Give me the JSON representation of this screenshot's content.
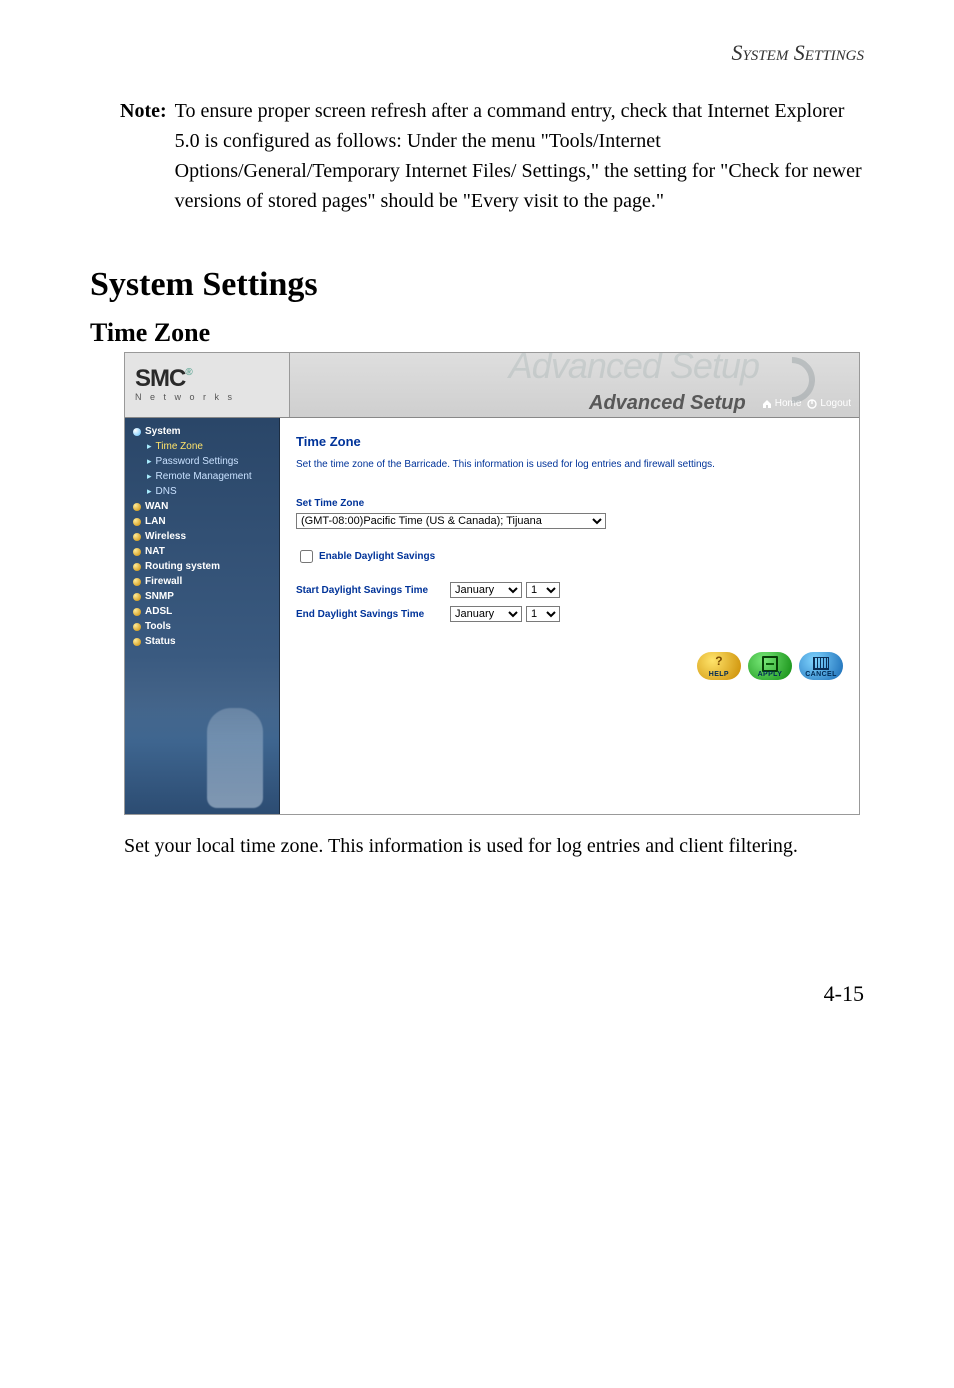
{
  "header_running": "System Settings",
  "note": {
    "label": "Note:",
    "body": "To ensure proper screen refresh after a command entry, check that Internet Explorer 5.0 is configured as follows: Under the menu \"Tools/Internet Options/General/Temporary Internet Files/ Settings,\" the setting for \"Check for newer versions of stored pages\" should be \"Every visit to the page.\""
  },
  "h1": "System Settings",
  "h2": "Time Zone",
  "ui": {
    "logo": {
      "brand": "SMC",
      "reg": "®",
      "sub": "N e t w o r k s"
    },
    "banner_ghost": "Advanced Setup",
    "title": "Advanced Setup",
    "home": "Home",
    "logout": "Logout",
    "sidebar": {
      "groups": [
        {
          "label": "System",
          "open": true,
          "items": [
            {
              "label": "Time Zone",
              "active": true
            },
            {
              "label": "Password Settings"
            },
            {
              "label": "Remote Management"
            },
            {
              "label": "DNS"
            }
          ]
        },
        {
          "label": "WAN"
        },
        {
          "label": "LAN"
        },
        {
          "label": "Wireless"
        },
        {
          "label": "NAT"
        },
        {
          "label": "Routing system"
        },
        {
          "label": "Firewall"
        },
        {
          "label": "SNMP"
        },
        {
          "label": "ADSL"
        },
        {
          "label": "Tools"
        },
        {
          "label": "Status"
        }
      ]
    },
    "panel": {
      "title": "Time Zone",
      "desc": "Set the time zone of the Barricade.  This information is used for log entries and firewall settings.",
      "setTZLabel": "Set Time Zone",
      "tzValue": "(GMT-08:00)Pacific Time (US & Canada); Tijuana",
      "dstLabel": "Enable Daylight Savings",
      "startLabel": "Start Daylight Savings Time",
      "startMonth": "January",
      "startDay": "1",
      "endLabel": "End Daylight Savings Time",
      "endMonth": "January",
      "endDay": "1",
      "buttons": {
        "help": "HELP",
        "apply": "APPLY",
        "cancel": "CANCEL"
      }
    }
  },
  "post_text": "Set your local time zone. This information is used for log entries and client filtering.",
  "page_num": "4-15"
}
